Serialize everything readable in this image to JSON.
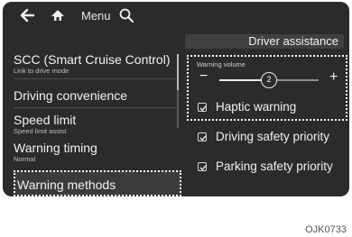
{
  "topbar": {
    "back_icon": "back-arrow-icon",
    "home_icon": "home-icon",
    "menu_label": "Menu",
    "search_icon": "search-icon"
  },
  "left_menu": {
    "items": [
      {
        "title": "SCC (Smart Cruise Control)",
        "subtitle": "Link to drive mode"
      },
      {
        "title": "Driving convenience",
        "subtitle": ""
      },
      {
        "title": "Speed limit",
        "subtitle": "Speed limit assist"
      },
      {
        "title": "Warning timing",
        "subtitle": "Normal"
      },
      {
        "title": "Warning methods",
        "subtitle": ""
      }
    ],
    "selected_index": 4
  },
  "right_panel": {
    "header": "Driver assistance",
    "warning_volume": {
      "label": "Warning volume",
      "value": "2",
      "level_fraction": 0.5,
      "minus_label": "−",
      "plus_label": "+"
    },
    "options": [
      {
        "label": "Haptic warning",
        "checked": true
      },
      {
        "label": "Driving safety priority",
        "checked": true
      },
      {
        "label": "Parking safety priority",
        "checked": true
      }
    ]
  },
  "footer_code": "OJK0733"
}
